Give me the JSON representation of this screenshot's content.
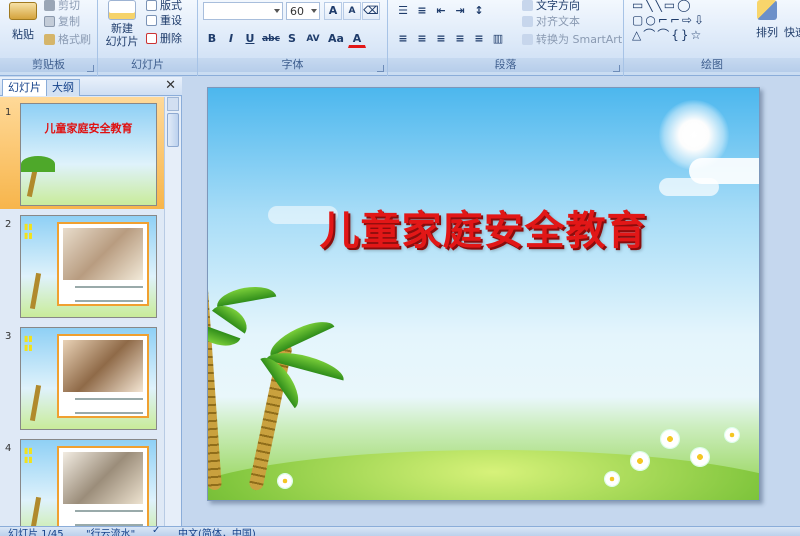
{
  "ribbon": {
    "clipboard": {
      "paste_label": "粘贴",
      "cut_label": "剪切",
      "copy_label": "复制",
      "format_painter_label": "格式刷",
      "group_label": "剪贴板"
    },
    "slides": {
      "new_slide_label": "新建\n幻灯片",
      "layout_label": "版式",
      "reset_label": "重设",
      "delete_label": "删除",
      "group_label": "幻灯片"
    },
    "font": {
      "font_name_value": "",
      "font_size_value": "60",
      "bold": "B",
      "italic": "I",
      "underline": "U",
      "strikethrough": "abc",
      "shadow": "S",
      "spacing": "AV",
      "change_case": "Aa",
      "font_color": "A",
      "grow": "A",
      "shrink": "A",
      "group_label": "字体"
    },
    "paragraph": {
      "text_direction_label": "文字方向",
      "align_text_label": "对齐文本",
      "smartart_label": "转换为 SmartArt",
      "group_label": "段落"
    },
    "drawing": {
      "arrange_label": "排列",
      "quick_styles_label": "快速",
      "group_label": "绘图"
    }
  },
  "left_panel": {
    "tab_slides": "幻灯片",
    "tab_outline": "大纲",
    "close_glyph": "✕",
    "thumbnails": [
      {
        "number": "1",
        "title": "儿童家庭安全教育",
        "selected": true
      },
      {
        "number": "2",
        "title": "",
        "selected": false
      },
      {
        "number": "3",
        "title": "",
        "selected": false
      },
      {
        "number": "4",
        "title": "",
        "selected": false
      }
    ]
  },
  "slide": {
    "title": "儿童家庭安全教育",
    "title_color": "#e21717"
  },
  "status": {
    "slide_counter": "幻灯片 1/45",
    "theme_name": "\"行云流水\"",
    "language": "中文(简体，中国)"
  },
  "icons": [
    "cut-icon",
    "copy-icon",
    "format-painter-icon",
    "paste-icon",
    "new-slide-icon",
    "layout-icon",
    "reset-icon",
    "delete-icon",
    "close-icon",
    "check-icon"
  ]
}
